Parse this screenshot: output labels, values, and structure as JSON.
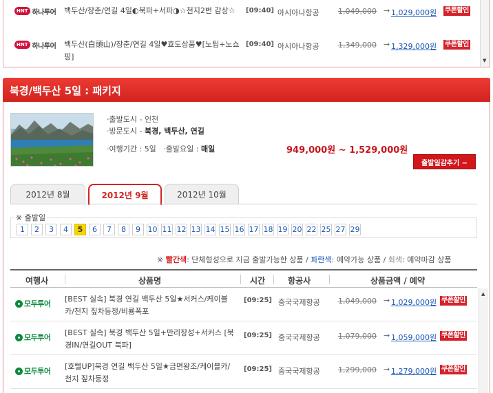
{
  "top_list": {
    "rows": [
      {
        "agency": "하나투어",
        "agency_badge": "HNT",
        "name": "백두산/장춘/연길 4일◐북파+서파◑☆천지2번 감상☆",
        "time": "[09:40]",
        "airline": "아시아나항공",
        "old_price": "1,049,000",
        "new_price": "1,029,000원",
        "coupon": "쿠폰할인"
      },
      {
        "agency": "하나투어",
        "agency_badge": "HNT",
        "name": "백두산(白頭山)/장춘/연길 4일♥효도상품♥[노팁+노쇼핑]",
        "time": "[09:40]",
        "airline": "아시아나항공",
        "old_price": "1,349,000",
        "new_price": "1,329,000원",
        "coupon": "쿠폰할인"
      }
    ]
  },
  "package": {
    "title": "북경/백두산 5일 : 패키지",
    "depart_city": "·출발도시 - 인천",
    "visit_city_prefix": "·방문도시 - ",
    "visit_city_cities": "북경, 백두산, 연길",
    "period_label": "·여행기간 : ",
    "period_value": "5일",
    "depart_day_label": "·출발요일 : ",
    "depart_day_value": "매일",
    "price_range": "949,000원 ~ 1,529,000원",
    "dates_button": "출발일감추기 −"
  },
  "tabs": [
    "2012년 8월",
    "2012년 9월",
    "2012년 10월"
  ],
  "active_tab": 1,
  "departure": {
    "title": "※ 출발일",
    "days": [
      "1",
      "2",
      "3",
      "4",
      "5",
      "6",
      "7",
      "8",
      "9",
      "10",
      "11",
      "12",
      "13",
      "14",
      "15",
      "16",
      "17",
      "18",
      "19",
      "20",
      "22",
      "25",
      "27",
      "29"
    ],
    "selected_day": "5"
  },
  "legend": {
    "mark": "※",
    "red_label": "빨간색",
    "red_text": ": 단체형성으로 지금 출발가능한 상품 / ",
    "blue_label": "파란색",
    "blue_text": ": 예약가능 상품 / ",
    "gray_label": "회색",
    "gray_text": ": 예약마감 상품"
  },
  "table": {
    "headers": {
      "agency": "여행사",
      "name": "상품명",
      "time": "시간",
      "airline": "항공사",
      "price": "상품금액 / 예약"
    },
    "rows": [
      {
        "agency": "모두투어",
        "name": "[BEST 실속] 북경 연길 백두산 5일★서커스/케이블카/천지 짚차등정/비룡폭포",
        "time": "[09:25]",
        "airline": "중국국제항공",
        "old_price": "1,049,000",
        "new_price": "1,029,000원",
        "coupon": "쿠폰할인"
      },
      {
        "agency": "모두투어",
        "name": "[BEST 실속] 북경 백두산 5일+만리장성+서커스 [북경IN/연길OUT 북파]",
        "time": "[09:25]",
        "airline": "중국국제항공",
        "old_price": "1,079,000",
        "new_price": "1,059,000원",
        "coupon": "쿠폰할인"
      },
      {
        "agency": "모두투어",
        "name": "[호텔UP]북경 연길 백두산 5일★금면왕조/케이블카/천지 짚차등정",
        "time": "[09:25]",
        "airline": "중국국제항공",
        "old_price": "1,299,000",
        "new_price": "1,279,000원",
        "coupon": "쿠폰할인"
      }
    ]
  },
  "colors": {
    "accent_red": "#d3231f",
    "link_blue": "#1a56b5",
    "modu_green": "#0b8a3c",
    "selected_day": "#f7d600"
  },
  "icons": {
    "scroll_up": "triangle-up-icon",
    "scroll_down": "triangle-down-icon",
    "price_arrow": "right-arrow-icon"
  }
}
